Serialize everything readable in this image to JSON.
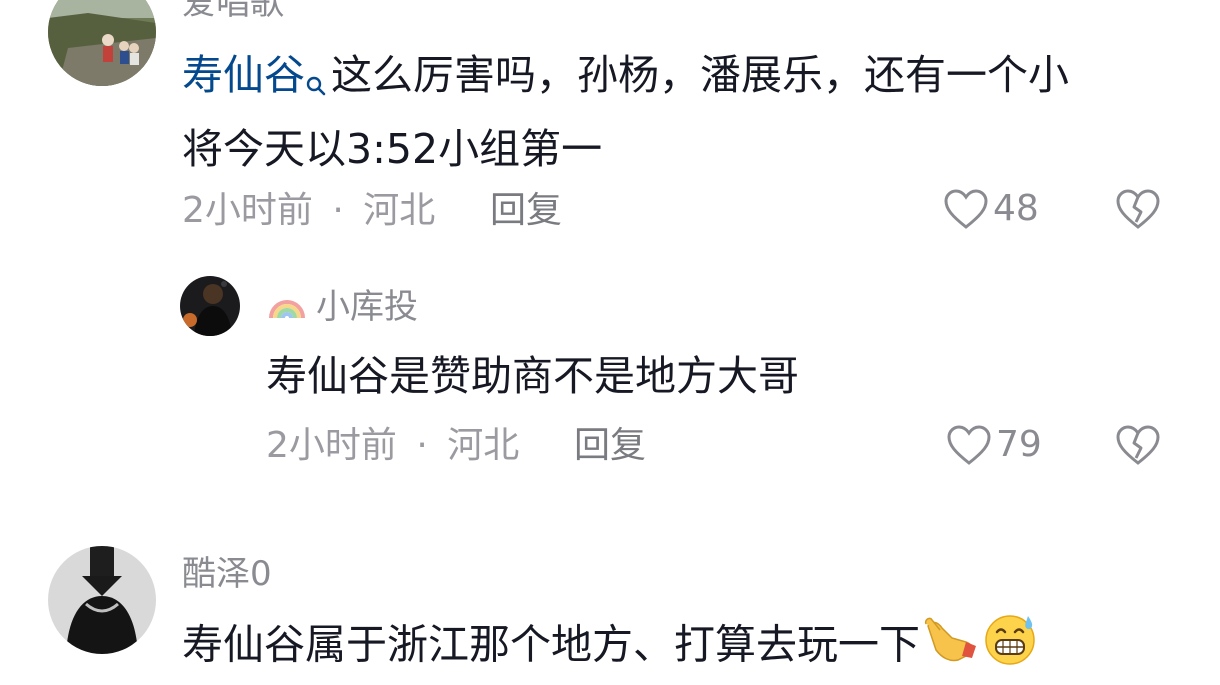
{
  "comments": [
    {
      "username": "爱唱歌",
      "content_link": "寿仙谷",
      "content_line1": "这么厉害吗，孙杨，潘展乐，还有一个小",
      "content_line2": "将今天以3:52小组第一",
      "time": "2小时前",
      "separator": "·",
      "location": "河北",
      "reply_label": "回复",
      "likes": "48"
    },
    {
      "username": "小库投",
      "content": "寿仙谷是赞助商不是地方大哥",
      "time": "2小时前",
      "separator": "·",
      "location": "河北",
      "reply_label": "回复",
      "likes": "79"
    },
    {
      "username": "酷泽0",
      "content": "寿仙谷属于浙江那个地方、打算去玩一下"
    }
  ],
  "colors": {
    "link": "#04498d",
    "text": "#161823",
    "meta": "#9a9aa0"
  }
}
